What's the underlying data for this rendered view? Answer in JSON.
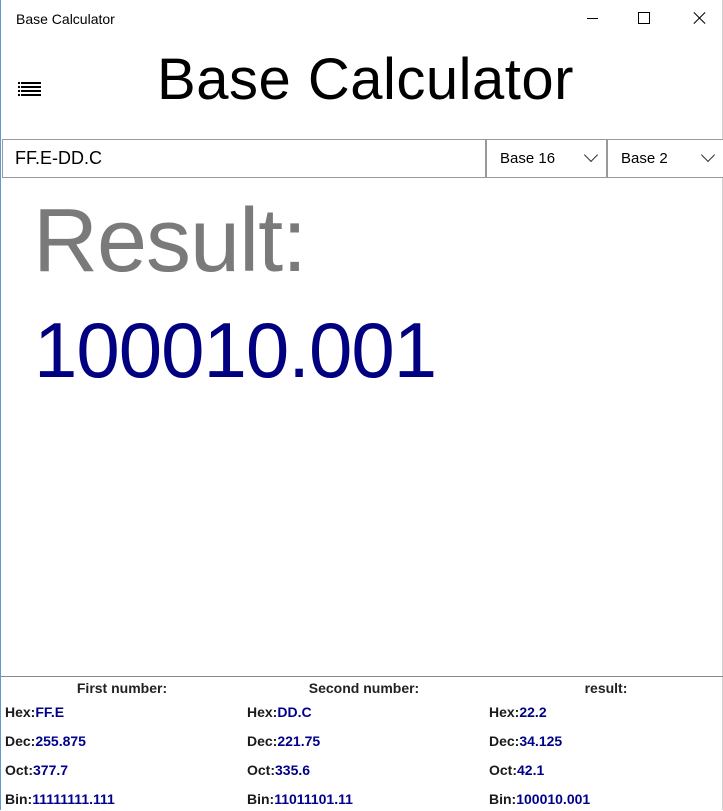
{
  "window": {
    "title": "Base Calculator",
    "controls": {
      "minimize": "minimize",
      "maximize": "maximize",
      "close": "close"
    }
  },
  "header": {
    "title": "Base Calculator",
    "menu_icon": "hamburger-list-icon"
  },
  "input": {
    "expression": "FF.E-DD.C",
    "from_base": "Base 16",
    "to_base": "Base 2"
  },
  "result": {
    "label": "Result:",
    "value": "100010.001"
  },
  "footer": {
    "columns": [
      {
        "heading": "First number:",
        "hex": "FF.E",
        "dec": "255.875",
        "oct": "377.7",
        "bin": "11111111.111"
      },
      {
        "heading": "Second number:",
        "hex": "DD.C",
        "dec": "221.75",
        "oct": "335.6",
        "bin": "11011101.11"
      },
      {
        "heading": "result:",
        "hex": "22.2",
        "dec": "34.125",
        "oct": "42.1",
        "bin": "100010.001"
      }
    ],
    "labels": {
      "hex": "Hex:",
      "dec": "Dec:",
      "oct": "Oct:",
      "bin": "Bin:"
    }
  },
  "colors": {
    "result_label": "#7a7a7a",
    "result_value": "#000080",
    "footer_value": "#00008b",
    "accent_border": "#5b9bd5"
  }
}
